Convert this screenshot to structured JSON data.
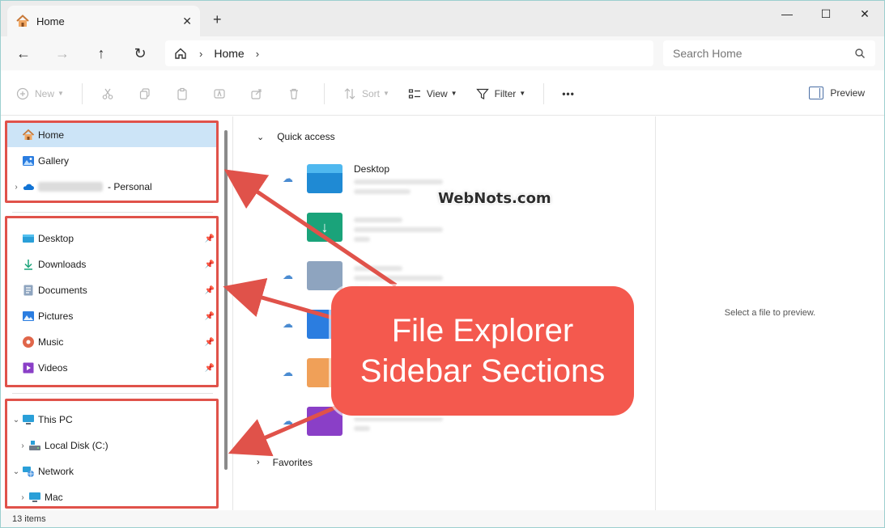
{
  "window": {
    "tab_title": "Home",
    "tab_close": "✕",
    "new_tab": "+",
    "minimize": "—",
    "maximize": "☐",
    "close": "✕"
  },
  "navigation": {
    "back": "←",
    "forward": "→",
    "up": "↑",
    "refresh": "↻",
    "breadcrumb": [
      "Home"
    ],
    "separator": "›",
    "search_placeholder": "Search Home"
  },
  "commands": {
    "new_label": "New",
    "sort_label": "Sort",
    "view_label": "View",
    "filter_label": "Filter",
    "more_label": "•••",
    "preview_label": "Preview"
  },
  "sidebar": {
    "section1": [
      {
        "label": "Home",
        "icon": "home-icon",
        "selected": true
      },
      {
        "label": "Gallery",
        "icon": "gallery-icon"
      },
      {
        "label": "- Personal",
        "icon": "onedrive-icon",
        "expandable": true
      }
    ],
    "section2": [
      {
        "label": "Desktop",
        "icon": "desktop-folder-icon"
      },
      {
        "label": "Downloads",
        "icon": "downloads-icon"
      },
      {
        "label": "Documents",
        "icon": "documents-icon"
      },
      {
        "label": "Pictures",
        "icon": "pictures-icon"
      },
      {
        "label": "Music",
        "icon": "music-icon"
      },
      {
        "label": "Videos",
        "icon": "videos-icon"
      }
    ],
    "section3": [
      {
        "label": "This PC",
        "icon": "pc-icon",
        "expanded": true
      },
      {
        "label": "Local Disk (C:)",
        "icon": "disk-icon",
        "expandable": true
      },
      {
        "label": "Network",
        "icon": "network-icon",
        "expanded": true
      },
      {
        "label": "Mac",
        "icon": "computer-icon",
        "expandable": true
      }
    ]
  },
  "main": {
    "quick_access_label": "Quick access",
    "favorites_label": "Favorites",
    "quick_access_items": [
      {
        "name": "Desktop",
        "cloud": true
      },
      {
        "name": "",
        "cloud": false
      },
      {
        "name": "",
        "cloud": true
      },
      {
        "name": "",
        "cloud": true
      },
      {
        "name": "",
        "cloud": true
      },
      {
        "name": "",
        "cloud": true
      }
    ]
  },
  "preview_pane": {
    "message": "Select a file to preview."
  },
  "status": {
    "items_count": "13 items"
  },
  "annotation": {
    "watermark": "WebNots.com",
    "callout_line1": "File Explorer",
    "callout_line2": "Sidebar Sections",
    "color": "#f4594e"
  }
}
